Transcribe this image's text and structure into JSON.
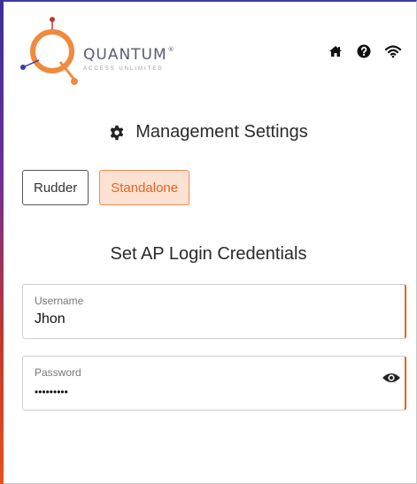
{
  "header": {
    "logo_text": "QUANTUM",
    "logo_tm": "®",
    "logo_tagline": "ACCESS UNLIMITED",
    "icons": [
      "home-icon",
      "help-icon",
      "wifi-icon"
    ]
  },
  "settings": {
    "title": "Management Settings",
    "modes": [
      {
        "label": "Rudder",
        "active": false
      },
      {
        "label": "Standalone",
        "active": true
      }
    ]
  },
  "credentials": {
    "title": "Set AP Login Credentials",
    "username": {
      "label": "Username",
      "value": "Jhon"
    },
    "password": {
      "label": "Password",
      "value": "•••••••••"
    }
  },
  "colors": {
    "accent": "#e8621e",
    "accent_bg": "#fde2d3",
    "top_border": "#3b3aa8"
  }
}
